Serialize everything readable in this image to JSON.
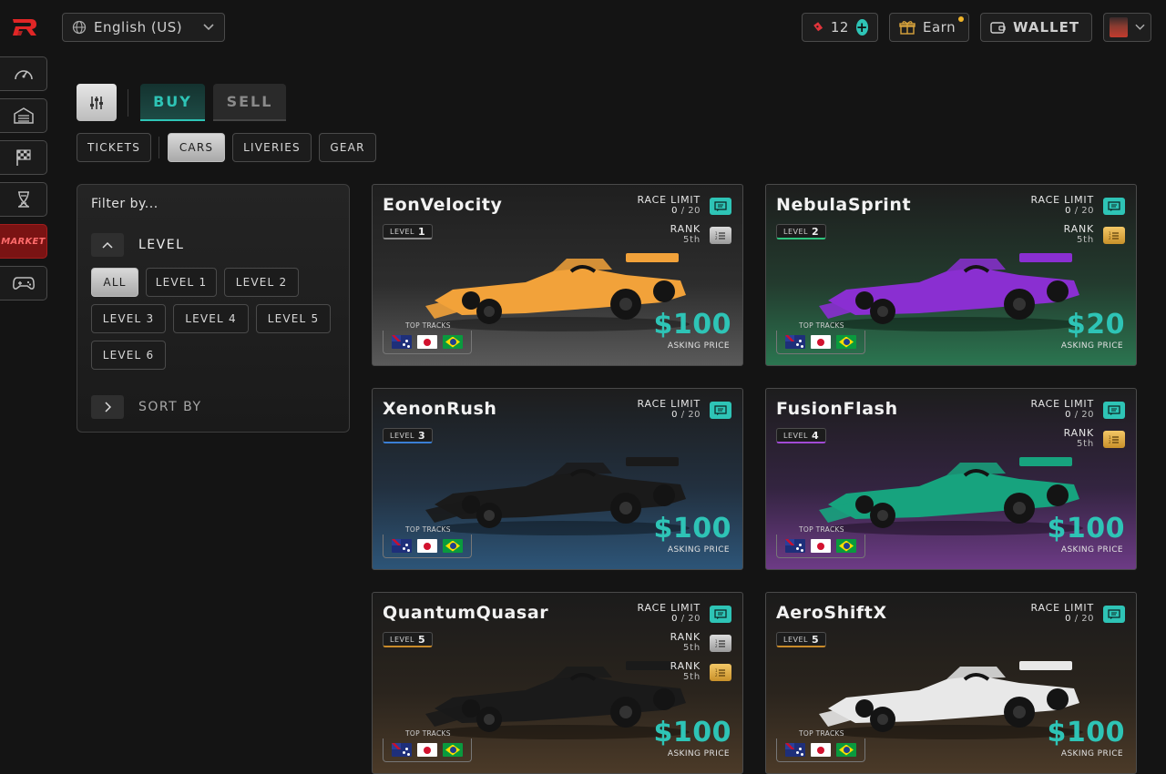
{
  "header": {
    "language": "English (US)",
    "tickets_count": "12",
    "earn_label": "Earn",
    "wallet_label": "WALLET"
  },
  "sidebar": {
    "items": [
      {
        "icon": "dashboard-gauge-icon"
      },
      {
        "icon": "garage-icon"
      },
      {
        "icon": "race-flag-icon"
      },
      {
        "icon": "dna-icon"
      },
      {
        "label": "MARKET"
      },
      {
        "icon": "gamepad-icon"
      }
    ]
  },
  "market": {
    "buy_label": "BUY",
    "sell_label": "SELL",
    "categories": [
      "TICKETS",
      "CARS",
      "LIVERIES",
      "GEAR"
    ],
    "active_category": "CARS"
  },
  "filter": {
    "title": "Filter by...",
    "level_header": "LEVEL",
    "levels": [
      "ALL",
      "LEVEL 1",
      "LEVEL 2",
      "LEVEL 3",
      "LEVEL 4",
      "LEVEL 5",
      "LEVEL 6"
    ],
    "sort_header": "SORT BY"
  },
  "card_labels": {
    "race_limit": "RACE LIMIT",
    "rank": "RANK",
    "level_prefix": "LEVEL",
    "top_tracks": "TOP TRACKS",
    "asking_price": "ASKING PRICE"
  },
  "cards": [
    {
      "name": "EonVelocity",
      "level": "1",
      "race_used": "0",
      "race_max": "20",
      "rank": "5th",
      "rank_color": "silver",
      "price": "$100",
      "theme": "gray",
      "car_color": "#f2a23a"
    },
    {
      "name": "NebulaSprint",
      "level": "2",
      "race_used": "0",
      "race_max": "20",
      "rank": "5th",
      "rank_color": "gold",
      "price": "$20",
      "theme": "green",
      "car_color": "#8a2fd1"
    },
    {
      "name": "XenonRush",
      "level": "3",
      "race_used": "0",
      "race_max": "20",
      "price": "$100",
      "theme": "blue",
      "car_color": "#1a1a1a"
    },
    {
      "name": "FusionFlash",
      "level": "4",
      "race_used": "0",
      "race_max": "20",
      "rank": "5th",
      "rank_color": "gold",
      "price": "$100",
      "theme": "purple",
      "car_color": "#17a37e"
    },
    {
      "name": "QuantumQuasar",
      "level": "5",
      "race_used": "0",
      "race_max": "20",
      "rank": "5th",
      "rank_color": "silver",
      "rank2": "5th",
      "rank2_color": "gold",
      "price": "$100",
      "theme": "brown",
      "car_color": "#1a1a1a"
    },
    {
      "name": "AeroShiftX",
      "level": "5",
      "race_used": "0",
      "race_max": "20",
      "price": "$100",
      "theme": "brown",
      "car_color": "#e8e8e8"
    }
  ],
  "colors": {
    "accent": "#2ec4b6",
    "market": "#7a1313",
    "gold": "#f0b429"
  }
}
